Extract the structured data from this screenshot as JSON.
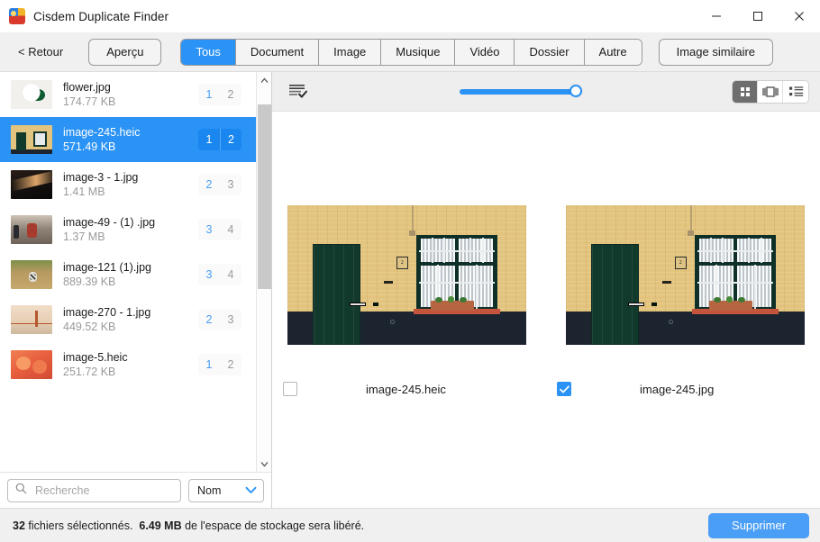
{
  "window": {
    "title": "Cisdem Duplicate Finder",
    "app_icon": "app-logo-icon",
    "minimize": "minimize-icon",
    "maximize": "maximize-icon",
    "close": "close-icon"
  },
  "toolbar": {
    "back_label": "< Retour",
    "preview_label": "Aperçu",
    "similar_image_label": "Image similaire",
    "filters": [
      {
        "label": "Tous",
        "active": true
      },
      {
        "label": "Document",
        "active": false
      },
      {
        "label": "Image",
        "active": false
      },
      {
        "label": "Musique",
        "active": false
      },
      {
        "label": "Vidéo",
        "active": false
      },
      {
        "label": "Dossier",
        "active": false
      },
      {
        "label": "Autre",
        "active": false
      }
    ]
  },
  "sidebar": {
    "files": [
      {
        "name": "flower.jpg",
        "size": "174.77 KB",
        "count_selected": "1",
        "count_total": "2",
        "selected": false,
        "thumb": "flower-thumb"
      },
      {
        "name": "image-245.heic",
        "size": "571.49 KB",
        "count_selected": "1",
        "count_total": "2",
        "selected": true,
        "thumb": "house-thumb"
      },
      {
        "name": "image-3 - 1.jpg",
        "size": "1.41 MB",
        "count_selected": "2",
        "count_total": "3",
        "selected": false,
        "thumb": "pier-thumb"
      },
      {
        "name": "image-49 - (1) .jpg",
        "size": "1.37 MB",
        "count_selected": "3",
        "count_total": "4",
        "selected": false,
        "thumb": "street-thumb"
      },
      {
        "name": "image-121 (1).jpg",
        "size": "889.39 KB",
        "count_selected": "3",
        "count_total": "4",
        "selected": false,
        "thumb": "dog-thumb"
      },
      {
        "name": "image-270 - 1.jpg",
        "size": "449.52 KB",
        "count_selected": "2",
        "count_total": "3",
        "selected": false,
        "thumb": "bridge-thumb"
      },
      {
        "name": "image-5.heic",
        "size": "251.72 KB",
        "count_selected": "1",
        "count_total": "2",
        "selected": false,
        "thumb": "flowers-thumb"
      }
    ],
    "search": {
      "placeholder": "Recherche",
      "value": "",
      "icon": "search-icon"
    },
    "sort": {
      "value": "Nom",
      "icon": "chevron-down-icon"
    },
    "scroll_up_icon": "chevron-up-icon",
    "scroll_down_icon": "chevron-down-icon"
  },
  "content": {
    "select_all_icon": "select-all-list-icon",
    "zoom_slider": {
      "value": "100",
      "min": "0",
      "max": "100"
    },
    "view_modes": [
      {
        "name": "grid-view-icon",
        "active": true
      },
      {
        "name": "coverflow-view-icon",
        "active": false
      },
      {
        "name": "list-view-icon",
        "active": false
      }
    ],
    "duplicates": [
      {
        "filename": "image-245.heic",
        "checked": false,
        "house_number": "2"
      },
      {
        "filename": "image-245.jpg",
        "checked": true,
        "house_number": "2"
      }
    ]
  },
  "statusbar": {
    "count": "32",
    "text_middle": "fichiers sélectionnés.",
    "size": "6.49 MB",
    "text_end": "de l'espace de stockage sera libéré.",
    "delete_label": "Supprimer"
  },
  "colors": {
    "accent": "#2b93f5",
    "accent_button": "#4a9ef5",
    "toolbar_bg": "#f0f0f0",
    "count_blue": "#4a9df0",
    "count_gray": "#9a9a9a"
  }
}
